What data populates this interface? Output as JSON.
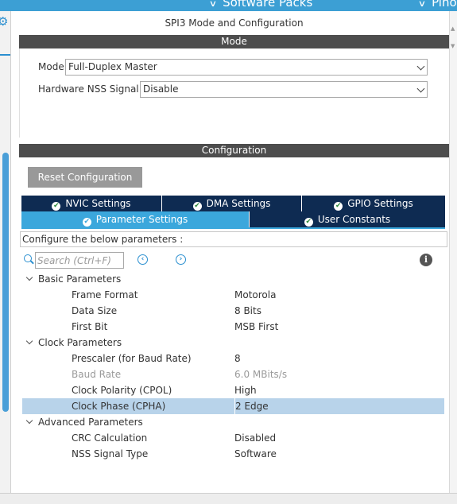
{
  "topbar": {
    "software_packs": "Software Packs",
    "pinout": "Pinout"
  },
  "panel": {
    "title": "SPI3 Mode and Configuration"
  },
  "mode_section": {
    "header": "Mode",
    "mode_label": "Mode",
    "mode_value": "Full-Duplex Master",
    "nss_label": "Hardware NSS Signal",
    "nss_value": "Disable"
  },
  "config_section": {
    "header": "Configuration",
    "reset_button": "Reset Configuration",
    "tabs": [
      {
        "label": "NVIC Settings",
        "active": false
      },
      {
        "label": "DMA Settings",
        "active": false
      },
      {
        "label": "GPIO Settings",
        "active": false
      },
      {
        "label": "Parameter Settings",
        "active": true
      },
      {
        "label": "User Constants",
        "active": false
      }
    ],
    "describe": "Configure the below parameters :",
    "search_placeholder": "Search (Ctrl+F)"
  },
  "parameters": {
    "basic": {
      "label": "Basic Parameters",
      "rows": [
        {
          "name": "Frame Format",
          "value": "Motorola"
        },
        {
          "name": "Data Size",
          "value": "8 Bits"
        },
        {
          "name": "First Bit",
          "value": "MSB First"
        }
      ]
    },
    "clock": {
      "label": "Clock Parameters",
      "rows": [
        {
          "name": "Prescaler (for Baud Rate)",
          "value": "8"
        },
        {
          "name": "Baud Rate",
          "value": "6.0 MBits/s"
        },
        {
          "name": "Clock Polarity (CPOL)",
          "value": "High"
        },
        {
          "name": "Clock Phase (CPHA)",
          "value": "2 Edge"
        }
      ]
    },
    "advanced": {
      "label": "Advanced Parameters",
      "rows": [
        {
          "name": "CRC Calculation",
          "value": "Disabled"
        },
        {
          "name": "NSS Signal Type",
          "value": "Software"
        }
      ]
    }
  },
  "colors": {
    "accent_blue": "#3ba7dc",
    "tab_navy": "#0e2b52",
    "header_gray": "#4d4d4d",
    "selected_row": "#b8d3ea"
  }
}
